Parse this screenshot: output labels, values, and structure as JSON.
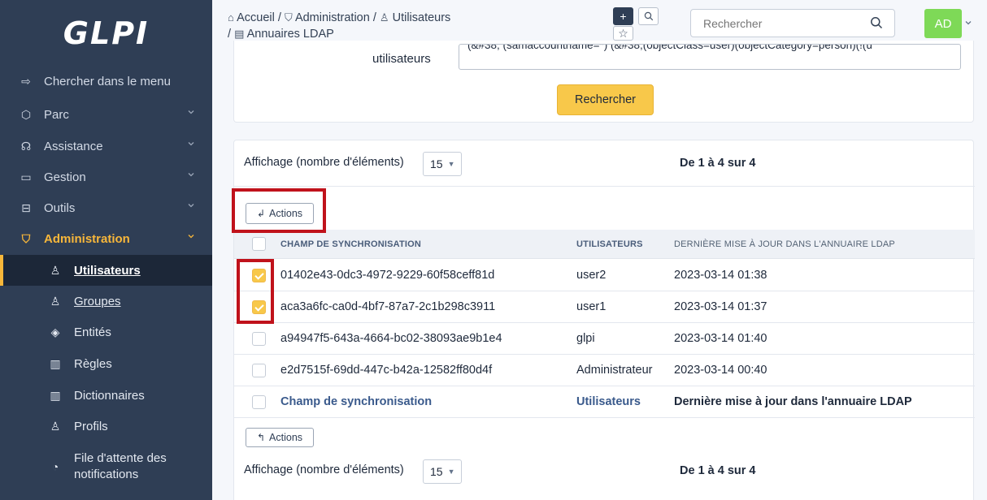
{
  "brand": {
    "logo": "GLPI"
  },
  "sidebar": {
    "search_label": "Chercher dans le menu",
    "items": [
      {
        "label": "Parc",
        "icon": "box-icon"
      },
      {
        "label": "Assistance",
        "icon": "headset-icon"
      },
      {
        "label": "Gestion",
        "icon": "wallet-icon"
      },
      {
        "label": "Outils",
        "icon": "briefcase-icon"
      },
      {
        "label": "Administration",
        "icon": "shield-icon"
      }
    ],
    "subitems": [
      {
        "label": "Utilisateurs",
        "icon": "user-icon"
      },
      {
        "label": "Groupes",
        "icon": "users-icon"
      },
      {
        "label": "Entités",
        "icon": "stack-icon"
      },
      {
        "label": "Règles",
        "icon": "book-icon"
      },
      {
        "label": "Dictionnaires",
        "icon": "book-icon"
      },
      {
        "label": "Profils",
        "icon": "user-check-icon"
      },
      {
        "label_line1": "File d'attente des",
        "label_line2": "notifications",
        "icon": "bell-icon"
      }
    ]
  },
  "header": {
    "breadcrumb": {
      "home": "Accueil",
      "sep": "/",
      "admin": "Administration",
      "users": "Utilisateurs",
      "ldap": "Annuaires LDAP"
    },
    "search_placeholder": "Rechercher",
    "avatar_initials": "AD"
  },
  "filter": {
    "label": "utilisateurs",
    "value": "(&#38; (samaccountname=*) (&#38;(objectClass=user)(objectCategory=person)(!(u",
    "search_button": "Rechercher"
  },
  "list": {
    "pager_label": "Affichage (nombre d'éléments)",
    "pager_value": "15",
    "count_text": "De 1 à 4 sur 4",
    "actions_label": "Actions",
    "columns": [
      "CHAMP DE SYNCHRONISATION",
      "UTILISATEURS",
      "DERNIÈRE MISE À JOUR DANS L'ANNUAIRE LDAP"
    ],
    "rows": [
      {
        "sync": "01402e43-0dc3-4972-9229-60f58ceff81d",
        "user": "user2",
        "updated": "2023-03-14 01:38",
        "checked": true
      },
      {
        "sync": "aca3a6fc-ca0d-4bf7-87a7-2c1b298c3911",
        "user": "user1",
        "updated": "2023-03-14 01:37",
        "checked": true
      },
      {
        "sync": "a94947f5-643a-4664-bc02-38093ae9b1e4",
        "user": "glpi",
        "updated": "2023-03-14 01:40",
        "checked": false
      },
      {
        "sync": "e2d7515f-69dd-447c-b42a-12582ff80d4f",
        "user": "Administrateur",
        "updated": "2023-03-14 00:40",
        "checked": false
      }
    ],
    "footer": [
      "Champ de synchronisation",
      "Utilisateurs",
      "Dernière mise à jour dans l'annuaire LDAP"
    ]
  },
  "colors": {
    "sidebar_bg": "#2f3e55",
    "accent": "#f8c84a",
    "highlight": "#c0121b",
    "avatar": "#7ed957"
  }
}
